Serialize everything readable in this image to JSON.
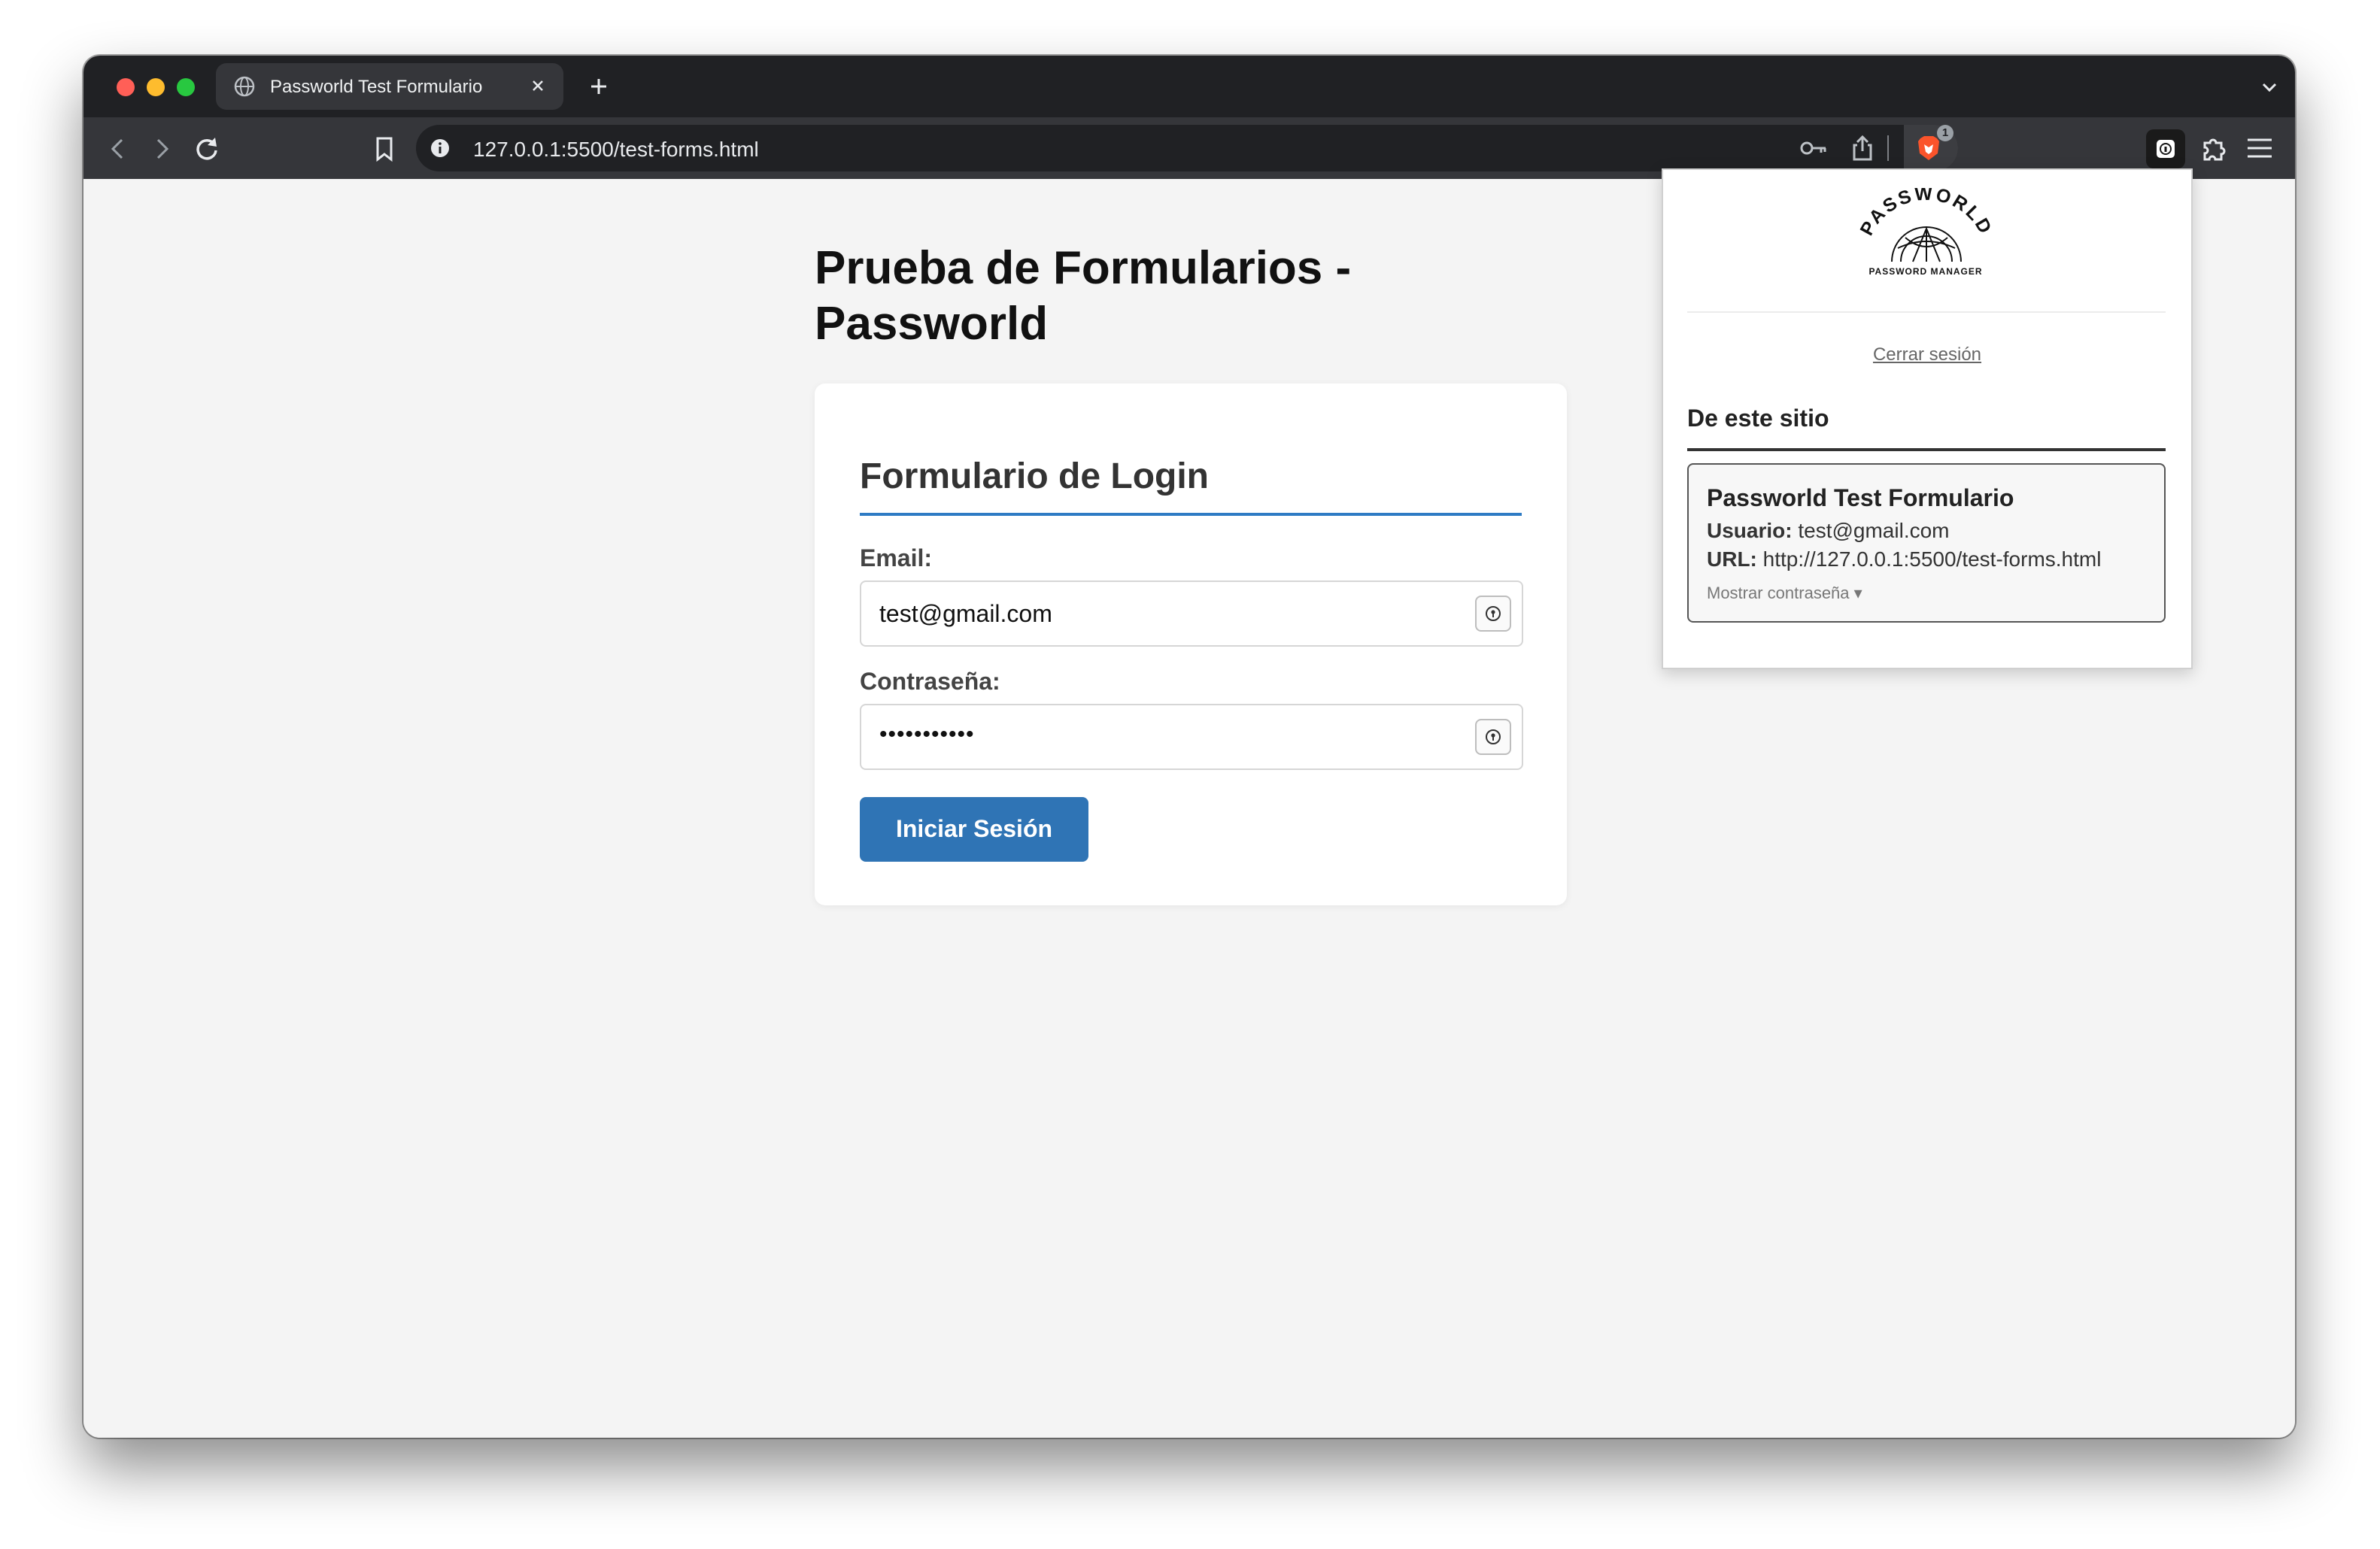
{
  "browser": {
    "tab_title": "Passworld Test Formulario",
    "url": "127.0.0.1:5500/test-forms.html",
    "brave_badge": "1"
  },
  "page": {
    "title_line1": "Prueba de Formularios -",
    "title_line2": "Passworld",
    "form": {
      "title": "Formulario de Login",
      "email_label": "Email:",
      "email_value": "test@gmail.com",
      "password_label": "Contraseña:",
      "password_value": "•••••••••••",
      "submit_label": "Iniciar Sesión"
    }
  },
  "popup": {
    "logo_text": "PASSWORLD",
    "logo_subtitle": "PASSWORD MANAGER",
    "logout_label": "Cerrar sesión",
    "section_title": "De este sitio",
    "credential": {
      "title": "Passworld Test Formulario",
      "user_label": "Usuario:",
      "user_value": "test@gmail.com",
      "url_label": "URL:",
      "url_value": "http://127.0.0.1:5500/test-forms.html",
      "show_password_label": "Mostrar contraseña ▾"
    }
  },
  "colors": {
    "accent_blue": "#2f74b5",
    "chrome_dark": "#202124",
    "toolbar": "#35363a",
    "page_bg": "#f4f4f4"
  }
}
